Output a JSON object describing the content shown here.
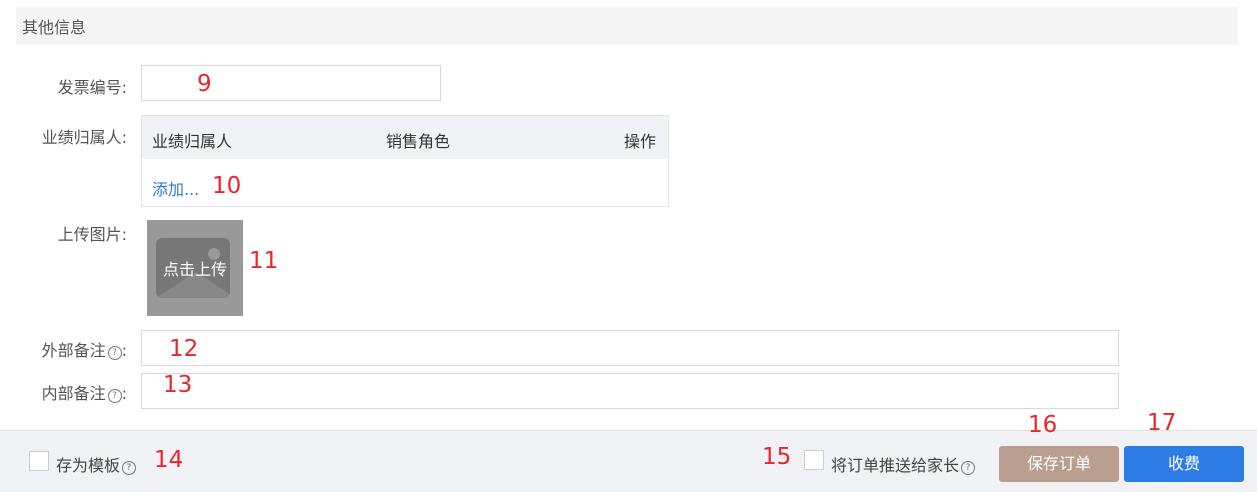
{
  "section": {
    "title": "其他信息"
  },
  "form": {
    "invoice_label": "发票编号:",
    "invoice_value": "",
    "performance_label": "业绩归属人:",
    "performance_table": {
      "columns": [
        "业绩归属人",
        "销售角色",
        "操作"
      ],
      "add_link": "添加..."
    },
    "upload_label": "上传图片:",
    "upload_text": "点击上传",
    "external_note_label": "外部备注",
    "internal_note_label": "内部备注",
    "colon": ":"
  },
  "footer": {
    "save_template_label": "存为模板",
    "push_to_parent_label": "将订单推送给家长",
    "save_order_button": "保存订单",
    "charge_button": "收费"
  },
  "annotations": [
    "9",
    "10",
    "11",
    "12",
    "13",
    "14",
    "15",
    "16",
    "17"
  ],
  "colors": {
    "section_bg": "#f5f5f5",
    "link": "#2e7ad6",
    "annotation": "#e8262b",
    "save_button": "#b89f8f",
    "charge_button": "#2e7ce6"
  },
  "icons": [
    "help-circle-icon",
    "image-placeholder-icon"
  ]
}
